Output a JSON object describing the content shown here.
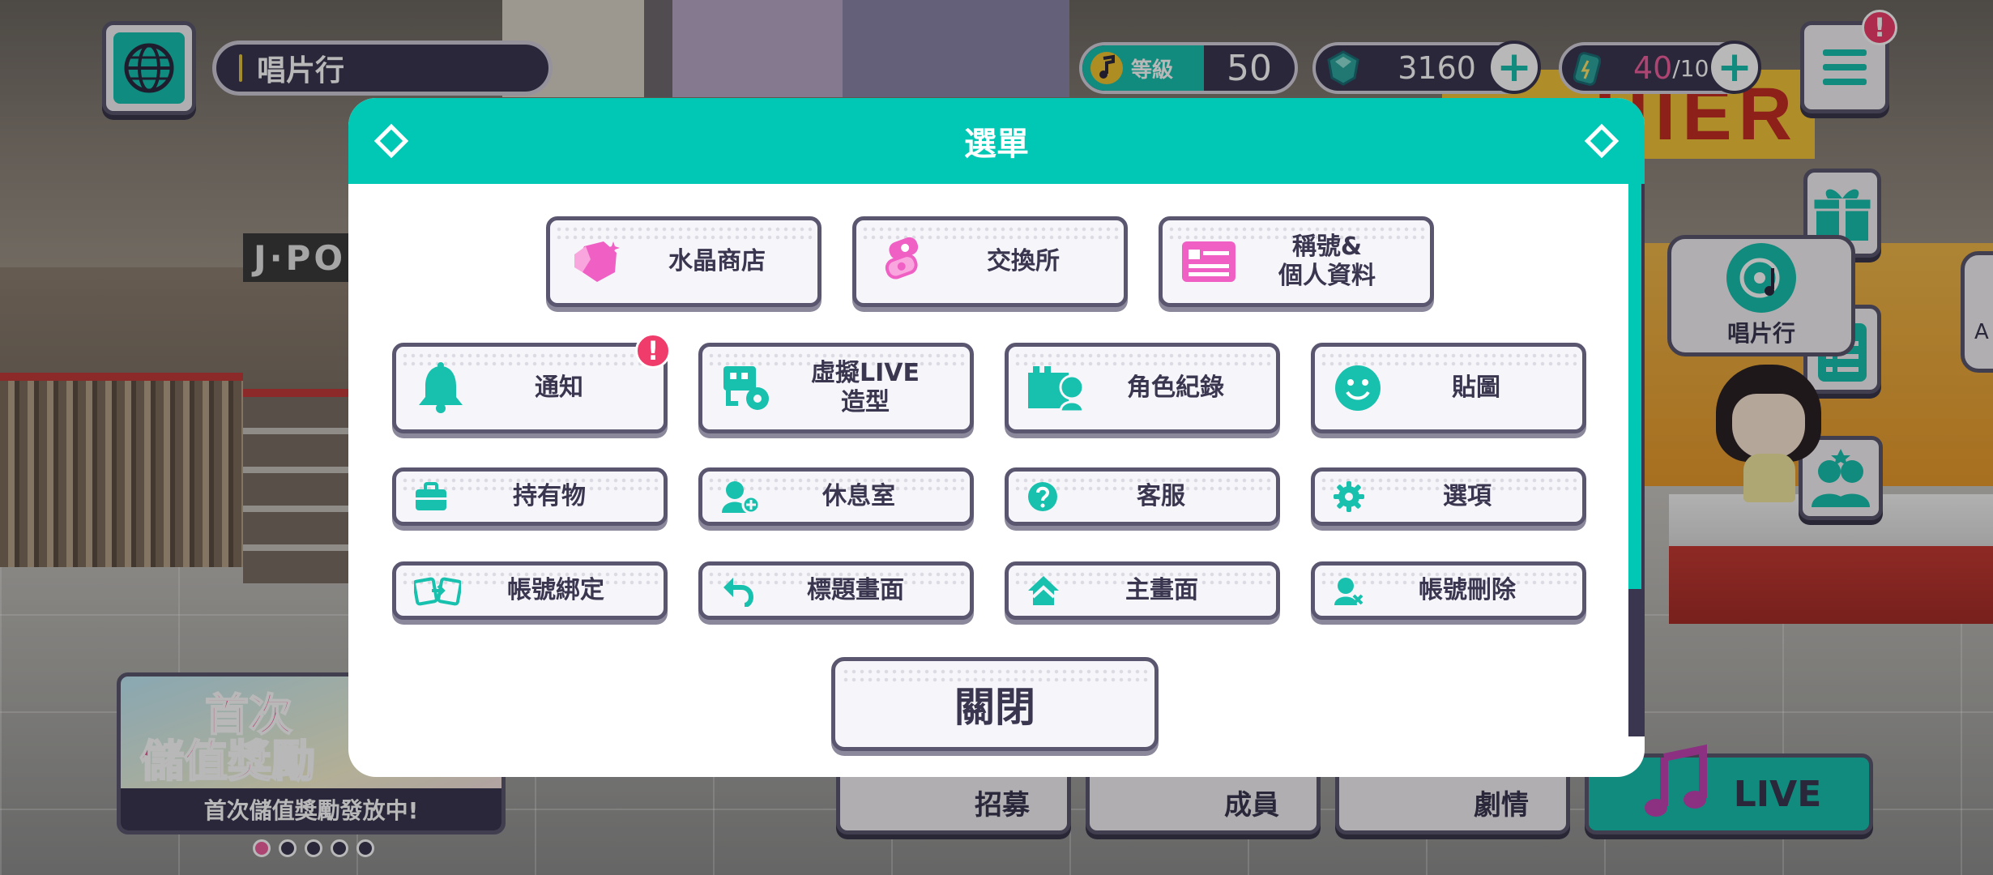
{
  "location": {
    "name": "唱片行"
  },
  "hud": {
    "level_label": "等級",
    "level_value": "50",
    "gems": "3160",
    "energy_current": "40",
    "energy_max": "/10",
    "menu_alert": "!"
  },
  "scene": {
    "jpop_sign": "J·PO",
    "cashier_sign": "HIER",
    "shop_bubble": "唱片行",
    "peek_bubble": "A"
  },
  "banner": {
    "headline_line1": "首次",
    "headline_line2": "儲值獎勵",
    "subtitle": "首次儲值獎勵發放中!"
  },
  "bottom_nav": {
    "gacha": "招募",
    "members": "成員",
    "story": "劇情",
    "live": "LIVE"
  },
  "modal": {
    "title": "選單",
    "close_label": "關閉",
    "notification_badge": "!",
    "buttons": {
      "crystal_shop": "水晶商店",
      "exchange": "交換所",
      "title_profile_l1": "稱號&",
      "title_profile_l2": "個人資料",
      "notice": "通知",
      "virtual_live_l1": "虛擬LIVE",
      "virtual_live_l2": "造型",
      "character_records": "角色紀錄",
      "stickers": "貼圖",
      "items": "持有物",
      "lounge": "休息室",
      "support": "客服",
      "options": "選項",
      "account_link": "帳號綁定",
      "title_screen": "標題畫面",
      "home": "主畫面",
      "delete_account": "帳號刪除"
    }
  },
  "colors": {
    "accent": "#00c8b4",
    "pink": "#f0609e",
    "dark": "#3a3650",
    "alert": "#f03c6b"
  }
}
